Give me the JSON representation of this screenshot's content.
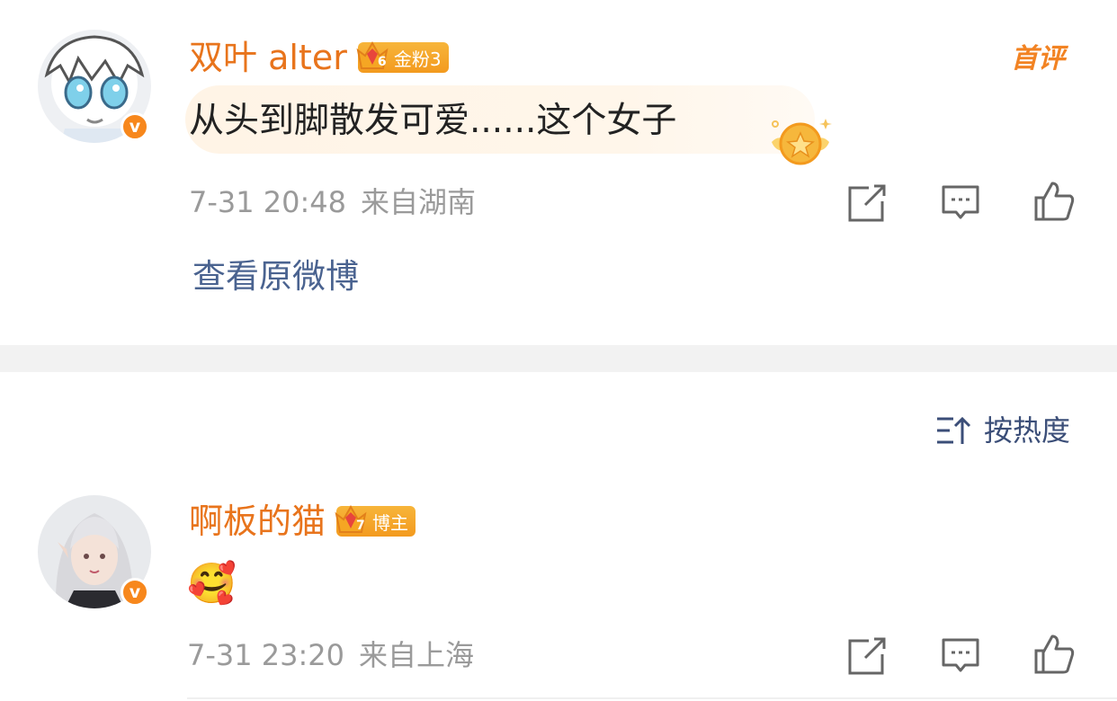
{
  "comment1": {
    "username": "双叶 alter",
    "badge": {
      "level": "6",
      "label": "金粉3"
    },
    "text": "从头到脚散发可爱......这个女子",
    "timestamp": "7-31 20:48",
    "location": "来自湖南",
    "hot_tag": "首评",
    "view_original": "查看原微博",
    "verified": "v"
  },
  "sort": {
    "label": "按热度",
    "icon": "sort-icon"
  },
  "comment2": {
    "username": "啊板的猫",
    "badge": {
      "level": "7",
      "label": "博主"
    },
    "emoji": "🥰",
    "timestamp": "7-31 23:20",
    "location": "来自上海",
    "verified": "v"
  },
  "actions": [
    {
      "icon": "share-icon"
    },
    {
      "icon": "comment-icon"
    },
    {
      "icon": "like-icon"
    }
  ],
  "colors": {
    "username": "#e8741c",
    "meta": "#9a9a9a",
    "link": "#4a6390",
    "badge": "#f39a1e",
    "divider": "#f2f2f2"
  }
}
